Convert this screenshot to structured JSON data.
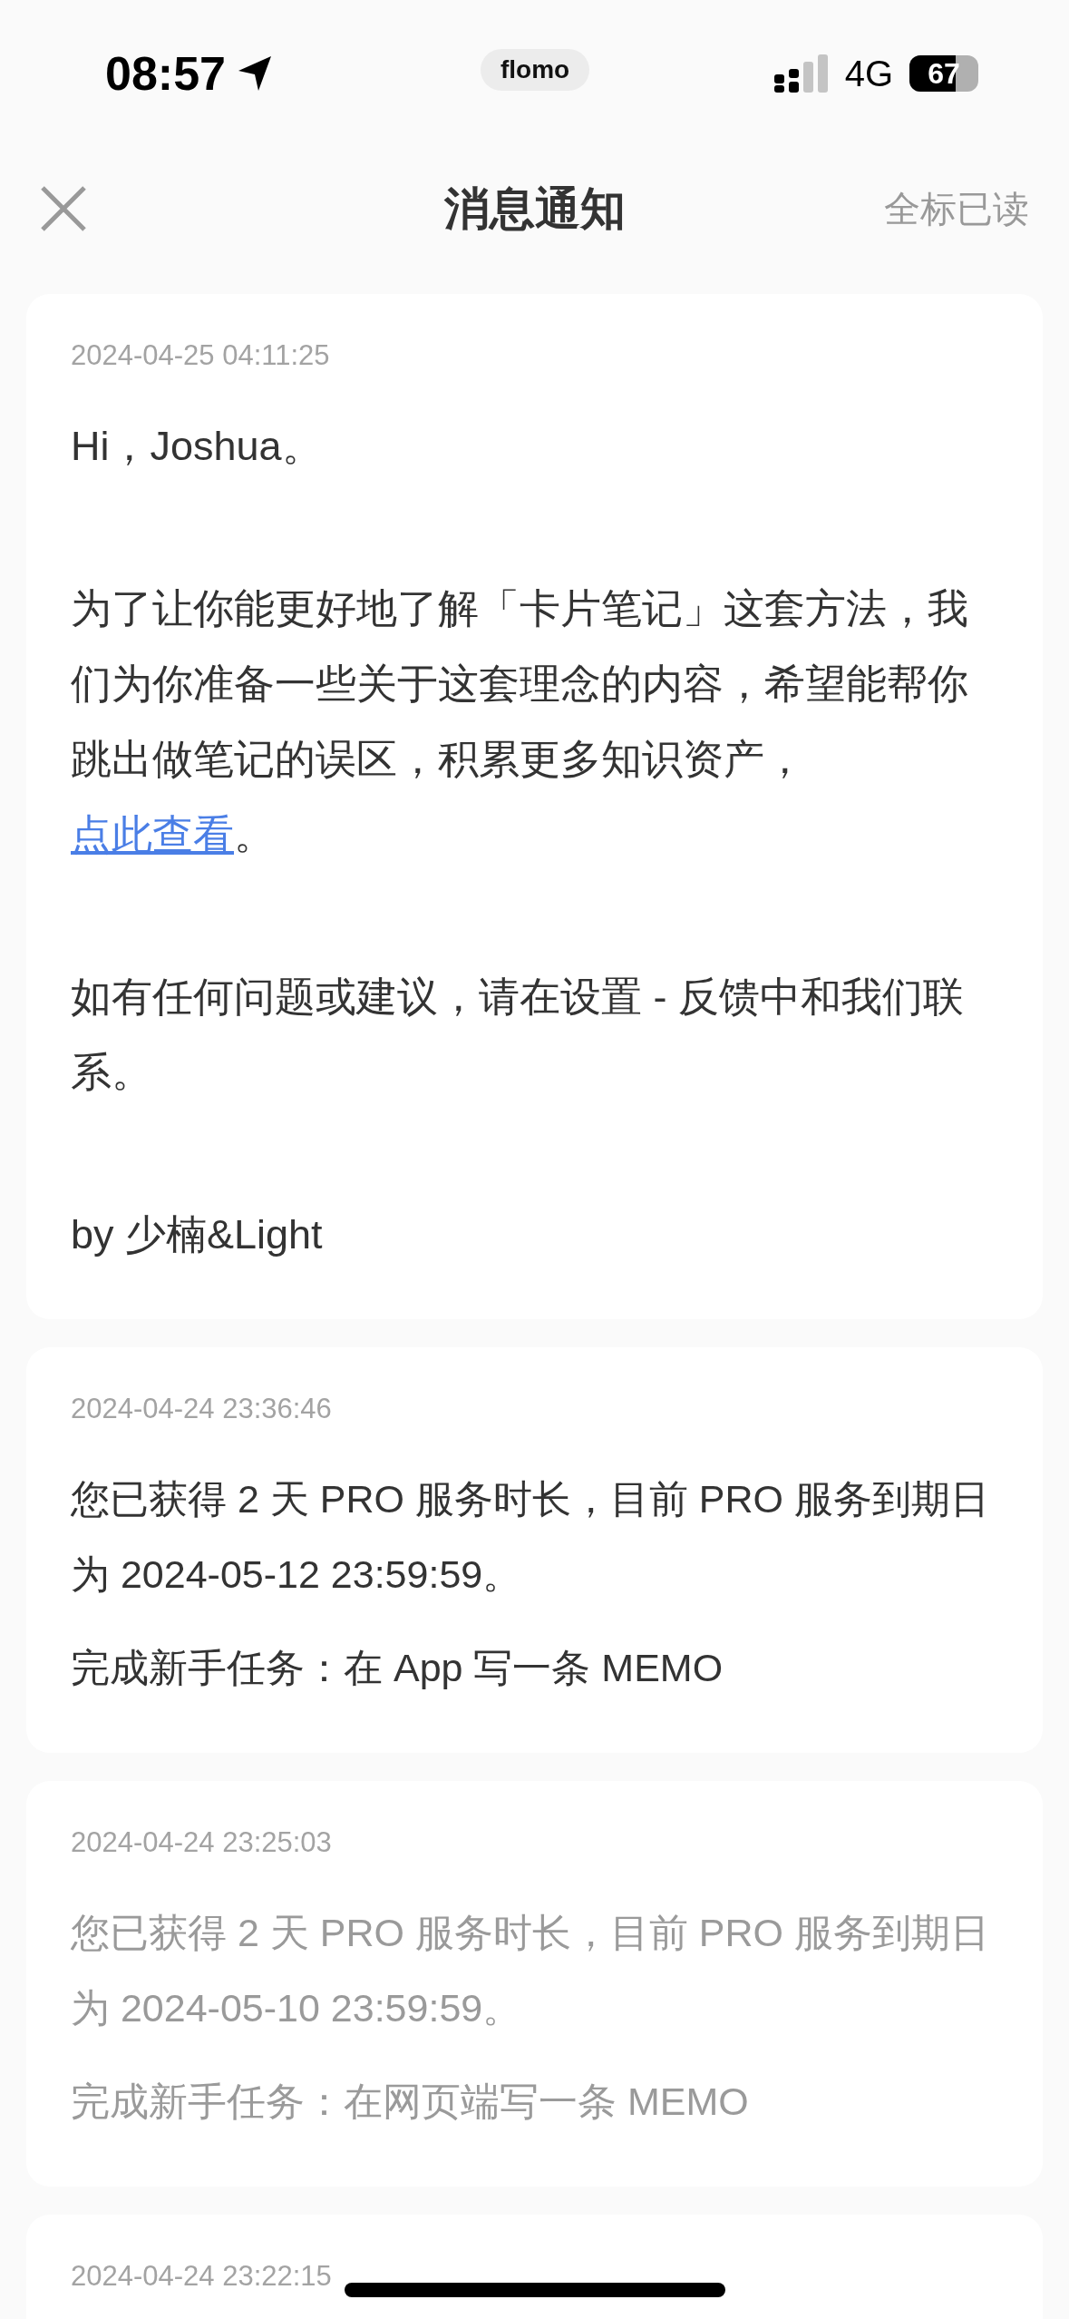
{
  "status_bar": {
    "time": "08:57",
    "pill": "flomo",
    "network": "4G",
    "battery": "67"
  },
  "header": {
    "title": "消息通知",
    "action": "全标已读"
  },
  "messages": [
    {
      "kind": "letter",
      "read": false,
      "time": "2024-04-25 04:11:25",
      "paragraphs": [
        {
          "text": "Hi，Joshua。"
        },
        {
          "text": "为了让你能更好地了解「卡片笔记」这套方法，我们为你准备一些关于这套理念的内容，希望能帮你跳出做笔记的误区，积累更多知识资产，",
          "link": "点此查看",
          "tail": "。"
        },
        {
          "text": "如有任何问题或建议，请在设置 - 反馈中和我们联系。"
        },
        {
          "text": "by 少楠&Light"
        }
      ]
    },
    {
      "kind": "reward",
      "read": false,
      "time": "2024-04-24 23:36:46",
      "paragraphs": [
        {
          "text": "您已获得 2 天 PRO 服务时长，目前 PRO 服务到期日为 2024-05-12 23:59:59。"
        },
        {
          "text": "完成新手任务：在 App 写一条 MEMO"
        }
      ]
    },
    {
      "kind": "reward",
      "read": true,
      "time": "2024-04-24 23:25:03",
      "paragraphs": [
        {
          "text": "您已获得 2 天 PRO 服务时长，目前 PRO 服务到期日为 2024-05-10 23:59:59。"
        },
        {
          "text": "完成新手任务：在网页端写一条 MEMO"
        }
      ]
    },
    {
      "kind": "reward",
      "time": "2024-04-24 23:22:15"
    }
  ]
}
